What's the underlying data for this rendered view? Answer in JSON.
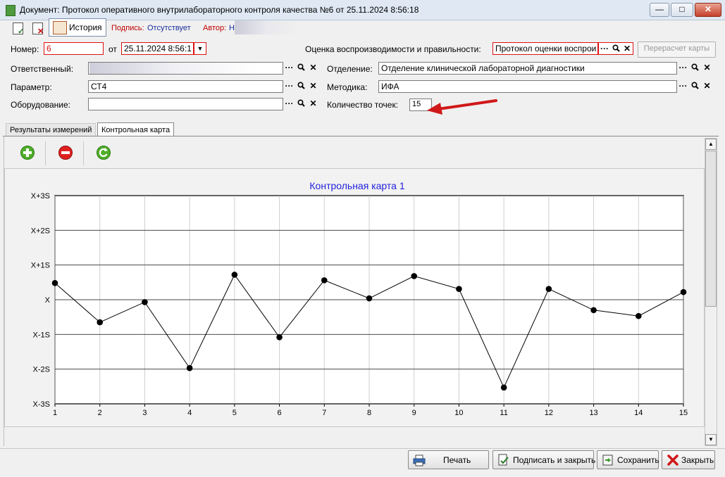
{
  "window": {
    "title": "Документ: Протокол оперативного внутрилабораторного контроля качества №6 от 25.11.2024 8:56:18"
  },
  "toolbar": {
    "history_label": "История",
    "sign_label": "Подпись:",
    "sign_value": "Отсутствует",
    "author_label": "Автор:",
    "author_value": "Н"
  },
  "form": {
    "number_label": "Номер:",
    "number_value": "6",
    "date_label": "от",
    "date_value": "25.11.2024 8:56:1",
    "assessment_label": "Оценка воспроизводимости и правильности:",
    "assessment_value": "Протокол оценки воспрои",
    "recalc_label": "Перерасчет карты",
    "responsible_label": "Ответственный:",
    "responsible_value": "",
    "department_label": "Отделение:",
    "department_value": "Отделение клинической лабораторной диагностики",
    "parameter_label": "Параметр:",
    "parameter_value": "СТ4",
    "method_label": "Методика:",
    "method_value": "ИФА",
    "equipment_label": "Оборудование:",
    "equipment_value": "",
    "points_label": "Количество точек:",
    "points_value": "15"
  },
  "tabs": [
    {
      "label": "Результаты измерений",
      "active": false
    },
    {
      "label": "Контрольная карта",
      "active": true
    }
  ],
  "chart_data": {
    "type": "line",
    "title": "Контрольная карта 1",
    "categories": [
      "1",
      "2",
      "3",
      "4",
      "5",
      "6",
      "7",
      "8",
      "9",
      "10",
      "11",
      "12",
      "13",
      "14",
      "15"
    ],
    "y_tick_labels": [
      "X-3S",
      "X-2S",
      "X-1S",
      "X",
      "X+1S",
      "X+2S",
      "X+3S"
    ],
    "ylim": [
      -3,
      3
    ],
    "series": [
      {
        "values": [
          0.48,
          -0.65,
          -0.07,
          -1.97,
          0.72,
          -1.08,
          0.56,
          0.04,
          0.68,
          0.31,
          -2.53,
          0.31,
          -0.3,
          -0.47,
          0.22
        ]
      }
    ],
    "title_color": "#2222dd",
    "grid": true,
    "legend": "none"
  },
  "bottom": {
    "print_label": "Печать",
    "sign_close_label": "Подписать и закрыть",
    "save_label": "Сохранить",
    "close_label": "Закрыть"
  }
}
